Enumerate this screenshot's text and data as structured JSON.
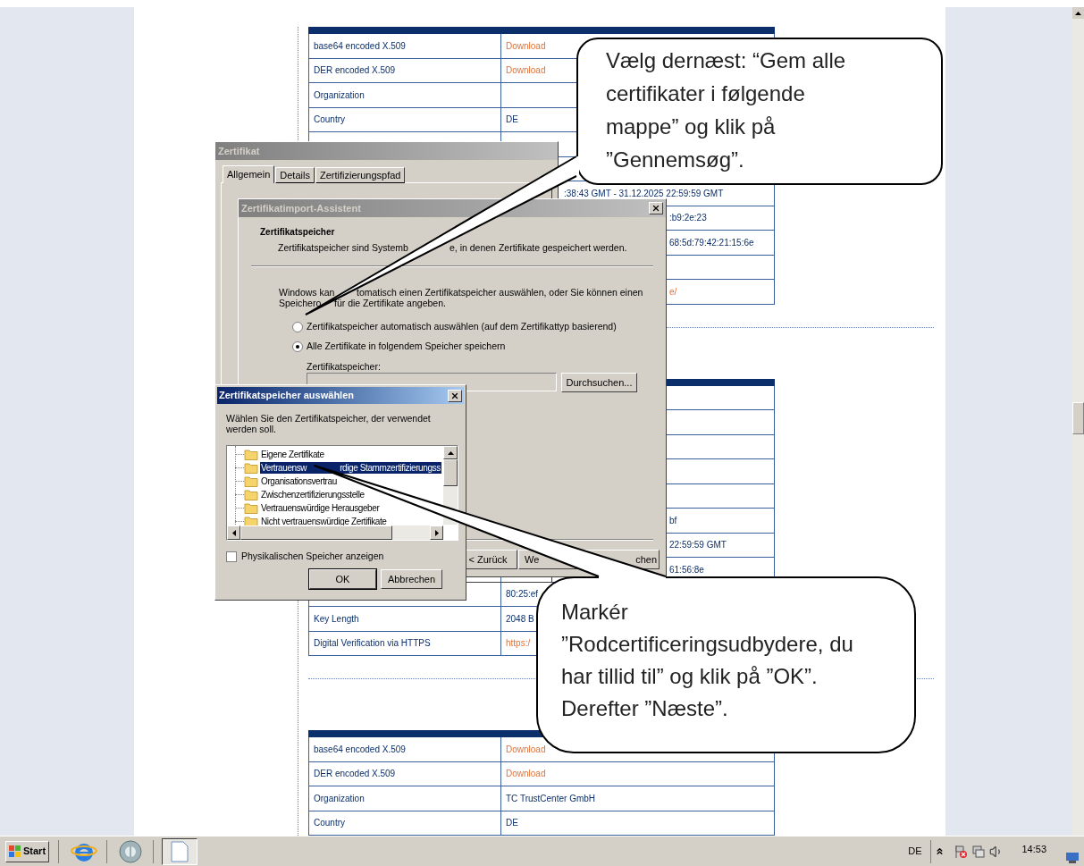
{
  "page": {
    "tables": [
      {
        "rows": [
          {
            "label": "base64 encoded X.509",
            "value": "Download",
            "link": true
          },
          {
            "label": "DER encoded X.509",
            "value": "Download",
            "link": true
          },
          {
            "label": "Organization"
          },
          {
            "label": "Country",
            "value": "DE",
            "link": false
          },
          {},
          {},
          {
            "value": ":38:43 GMT - 31.12.2025 22:59:59 GMT",
            "link": false
          },
          {
            "value": ":b9:2e:23",
            "link": false
          },
          {
            "value": "68:5d:79:42:21:15:6e",
            "link": false
          },
          {},
          {
            "value": "e/",
            "link": true
          }
        ]
      },
      {
        "rows": [
          {},
          {},
          {},
          {},
          {},
          {
            "value": "bf",
            "link": false
          },
          {
            "value": "22:59:59 GMT",
            "link": false
          },
          {
            "value": "61:56:8e",
            "link": false
          },
          {
            "value": "80:25:ef",
            "link": false
          },
          {
            "label": "Key Length",
            "value": "2048 B",
            "link": false
          },
          {
            "label": "Digital Verification via HTTPS",
            "value": "https:/",
            "link": true
          }
        ]
      },
      {
        "rows": [
          {
            "label": "base64 encoded X.509",
            "value": "Download",
            "link": true
          },
          {
            "label": "DER encoded X.509",
            "value": "Download",
            "link": true
          },
          {
            "label": "Organization",
            "value": "TC TrustCenter GmbH",
            "link": false
          },
          {
            "label": "Country",
            "value": "DE",
            "link": false
          }
        ]
      }
    ]
  },
  "certificate_window": {
    "title": "Zertifikat",
    "tabs": [
      {
        "label": "Allgemein",
        "selected": true
      },
      {
        "label": "Details",
        "selected": false
      },
      {
        "label": "Zertifizierungspfad",
        "selected": false
      }
    ]
  },
  "import_wizard": {
    "title": "Zertifikatimport-Assistent",
    "heading": "Zertifikatspeicher",
    "description": [
      "Zertifikatspeicher sind Systemb",
      "e, in denen Zertifikate gespeichert werden."
    ],
    "intro_lines": [
      [
        "Windows kan",
        "tomatisch einen Zertifikatspeicher auswählen, oder Sie können einen"
      ],
      [
        "Speichero",
        "für die Zertifikate angeben."
      ]
    ],
    "options": [
      {
        "label": "Zertifikatspeicher automatisch auswählen (auf dem Zertifikattyp basierend)",
        "selected": false
      },
      {
        "label": "Alle Zertifikate in folgendem Speicher speichern",
        "selected": true
      }
    ],
    "store_label": "Zertifikatspeicher:",
    "browse_button": "Durchsuchen...",
    "buttons": [
      "< Zurück",
      "We",
      "chen"
    ]
  },
  "store_dialog": {
    "title": "Zertifikatspeicher auswählen",
    "prompt": "Wählen Sie den Zertifikatspeicher, der verwendet werden soll.",
    "stores": [
      {
        "parts": [
          "Eigene Zertifikate"
        ],
        "selected": false
      },
      {
        "parts": [
          "Vertrauensw",
          "rdige Stammzertifizierungss"
        ],
        "selected": true
      },
      {
        "parts": [
          "Organisationsvertrau"
        ],
        "selected": false
      },
      {
        "parts": [
          "Zwischenzertifizierungsstelle"
        ],
        "selected": false
      },
      {
        "parts": [
          "Vertrauenswürdige Herausgeber"
        ],
        "selected": false
      },
      {
        "parts": [
          "Nicht vertrauenswürdige Zertifikate"
        ],
        "selected": false
      }
    ],
    "physical_checkbox": {
      "label": "Physikalischen Speicher anzeigen",
      "checked": false
    },
    "buttons": [
      "OK",
      "Abbrechen"
    ]
  },
  "callouts": [
    {
      "text": "Vælg dernæst: “Gem alle certifikater i følgende mappe” og klik på ”Gennemsøg”."
    },
    {
      "text": "Markér ”Rodcertificeringsudbydere, du har tillid til” og klik på ”OK”. Derefter ”Næste”."
    }
  ],
  "taskbar": {
    "start": "Start",
    "language": "DE",
    "clock": "14:53"
  }
}
